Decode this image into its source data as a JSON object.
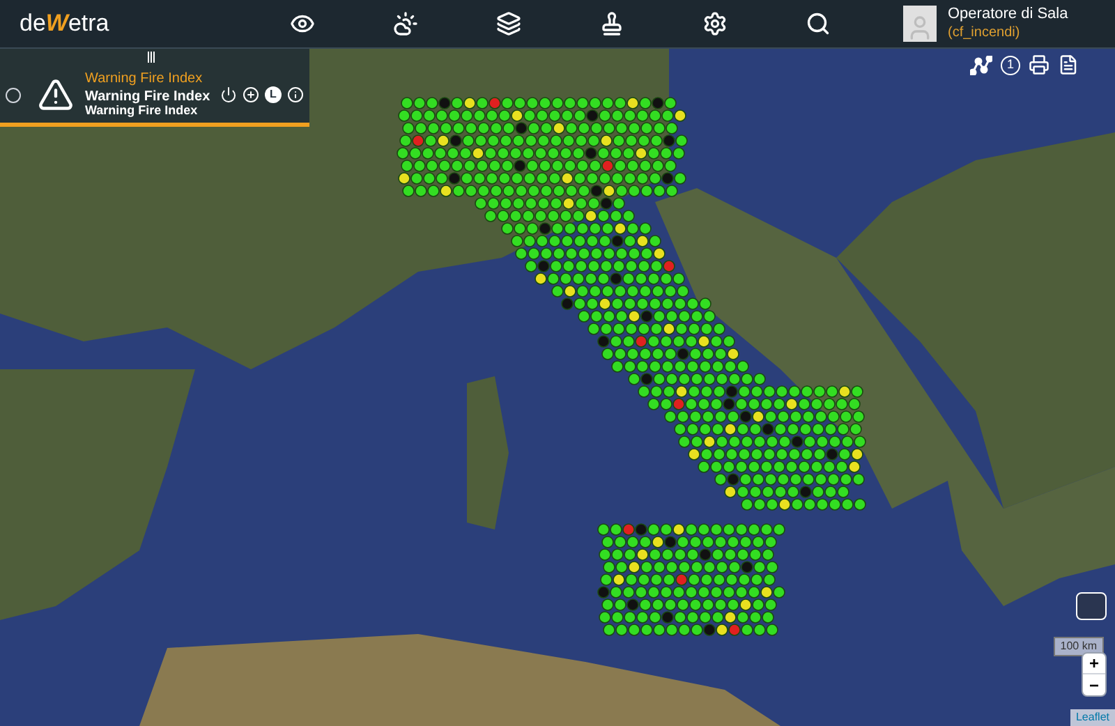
{
  "header": {
    "logo": {
      "prefix": "de",
      "mark": "W",
      "suffix": "etra"
    },
    "nav": [
      {
        "kind": "eye"
      },
      {
        "kind": "weather"
      },
      {
        "kind": "layers"
      },
      {
        "kind": "stamp"
      },
      {
        "kind": "settings"
      },
      {
        "kind": "globe-search"
      }
    ],
    "user": {
      "name": "Operatore di Sala",
      "role": "(cf_incendi)"
    }
  },
  "layer_panel": {
    "category": "Warning Fire Index",
    "title": "Warning Fire Index",
    "subtitle": "Warning Fire Index",
    "legend_button": "L"
  },
  "map_toolbar": {
    "counter": "1"
  },
  "map_controls": {
    "scale": "100 km",
    "zoom_in": "+",
    "zoom_out": "−",
    "attribution": "Leaflet"
  }
}
